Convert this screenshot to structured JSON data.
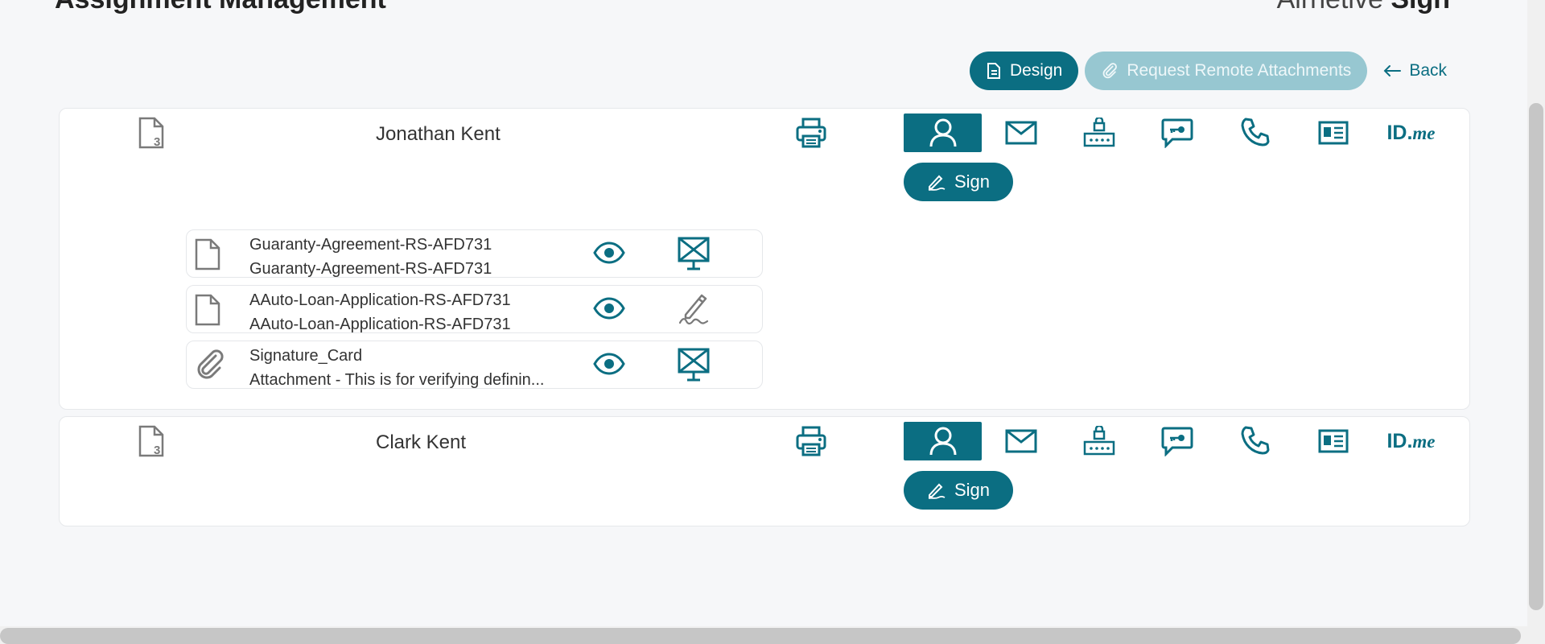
{
  "header": {
    "title": "Assignment Management",
    "brand_light": "Airnetive",
    "brand_bold": "Sign"
  },
  "toolbar": {
    "design_label": "Design",
    "request_label": "Request Remote Attachments",
    "back_label": "Back"
  },
  "signers": [
    {
      "name": "Jonathan Kent",
      "doc_count": "3",
      "sign_label": "Sign",
      "idme_label": "ID.",
      "idme_suffix": "me",
      "documents": [
        {
          "line1": "Guaranty-Agreement-RS-AFD731",
          "line2": "Guaranty-Agreement-RS-AFD731",
          "type_icon": "file-icon",
          "status_icon": "in-person-x-icon"
        },
        {
          "line1": "AAuto-Loan-Application-RS-AFD731",
          "line2": "AAuto-Loan-Application-RS-AFD731",
          "type_icon": "file-icon",
          "status_icon": "signature-icon"
        },
        {
          "line1": "Signature_Card",
          "line2": "Attachment - This is for verifying definin...",
          "type_icon": "paperclip-icon",
          "status_icon": "in-person-x-icon"
        }
      ]
    },
    {
      "name": "Clark Kent",
      "doc_count": "3",
      "sign_label": "Sign",
      "idme_label": "ID.",
      "idme_suffix": "me"
    }
  ],
  "colors": {
    "primary": "#0b6e82",
    "primary_disabled": "#97c7d1",
    "icon_gray": "#7a7a7a"
  }
}
